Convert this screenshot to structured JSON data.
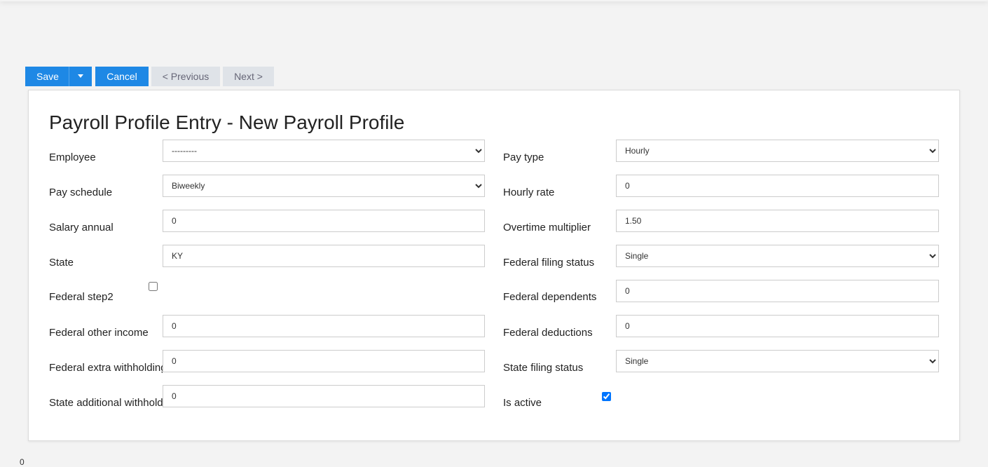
{
  "toolbar": {
    "save_label": "Save",
    "cancel_label": "Cancel",
    "previous_label": "< Previous",
    "next_label": "Next >"
  },
  "form": {
    "title": "Payroll Profile Entry - New Payroll Profile",
    "left": {
      "employee": {
        "label": "Employee",
        "value": "---------"
      },
      "pay_schedule": {
        "label": "Pay schedule",
        "value": "Biweekly"
      },
      "salary_annual": {
        "label": "Salary annual",
        "value": "0"
      },
      "state": {
        "label": "State",
        "value": "KY"
      },
      "federal_step2": {
        "label": "Federal step2",
        "checked": false
      },
      "federal_other_income": {
        "label": "Federal other income",
        "value": "0"
      },
      "federal_extra_withholding": {
        "label": "Federal extra withholding",
        "value": "0"
      },
      "state_additional_withholding": {
        "label": "State additional withholding",
        "value": "0"
      }
    },
    "right": {
      "pay_type": {
        "label": "Pay type",
        "value": "Hourly"
      },
      "hourly_rate": {
        "label": "Hourly rate",
        "value": "0"
      },
      "overtime_multiplier": {
        "label": "Overtime multiplier",
        "value": "1.50"
      },
      "federal_filing_status": {
        "label": "Federal filing status",
        "value": "Single"
      },
      "federal_dependents": {
        "label": "Federal dependents",
        "value": "0"
      },
      "federal_deductions": {
        "label": "Federal deductions",
        "value": "0"
      },
      "state_filing_status": {
        "label": "State filing status",
        "value": "Single"
      },
      "is_active": {
        "label": "Is active",
        "checked": true
      }
    }
  },
  "footer_mark": "0",
  "colors": {
    "primary": "#1e88e5",
    "disabled": "#dfe3e8",
    "background": "#f3f3f3"
  }
}
